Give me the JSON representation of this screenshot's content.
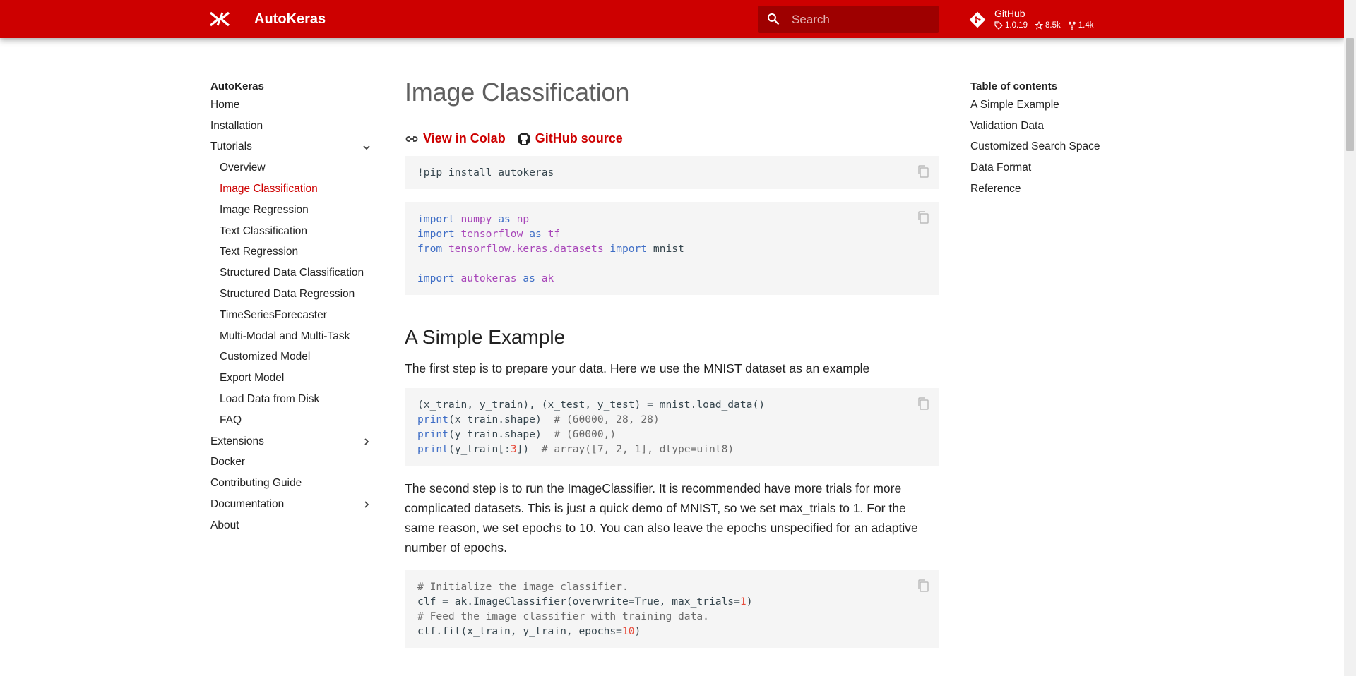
{
  "header": {
    "site_title": "AutoKeras",
    "search_placeholder": "Search",
    "repo": {
      "name": "GitHub",
      "version": "1.0.19",
      "stars": "8.5k",
      "forks": "1.4k"
    }
  },
  "nav": {
    "title": "AutoKeras",
    "items": [
      {
        "label": "Home"
      },
      {
        "label": "Installation"
      },
      {
        "label": "Tutorials"
      },
      {
        "label": "Overview"
      },
      {
        "label": "Image Classification"
      },
      {
        "label": "Image Regression"
      },
      {
        "label": "Text Classification"
      },
      {
        "label": "Text Regression"
      },
      {
        "label": "Structured Data Classification"
      },
      {
        "label": "Structured Data Regression"
      },
      {
        "label": "TimeSeriesForecaster"
      },
      {
        "label": "Multi-Modal and Multi-Task"
      },
      {
        "label": "Customized Model"
      },
      {
        "label": "Export Model"
      },
      {
        "label": "Load Data from Disk"
      },
      {
        "label": "FAQ"
      },
      {
        "label": "Extensions"
      },
      {
        "label": "Docker"
      },
      {
        "label": "Contributing Guide"
      },
      {
        "label": "Documentation"
      },
      {
        "label": "About"
      }
    ]
  },
  "main": {
    "title": "Image Classification",
    "colab_link": "View in Colab",
    "github_link": "GitHub source",
    "section1_heading": "A Simple Example",
    "para1": "The first step is to prepare your data. Here we use the MNIST dataset as an example",
    "para2": "The second step is to run the ImageClassifier. It is recommended have more trials for more complicated datasets. This is just a quick demo of MNIST, so we set max_trials to 1. For the same reason, we set epochs to 10. You can also leave the epochs unspecified for an adaptive number of epochs."
  },
  "toc": {
    "title": "Table of contents",
    "items": [
      {
        "label": "A Simple Example"
      },
      {
        "label": "Validation Data"
      },
      {
        "label": "Customized Search Space"
      },
      {
        "label": "Data Format"
      },
      {
        "label": "Reference"
      }
    ]
  },
  "colors": {
    "primary": "#cd0000",
    "search_bg": "#9e0000",
    "code_bg": "#f5f5f5"
  }
}
